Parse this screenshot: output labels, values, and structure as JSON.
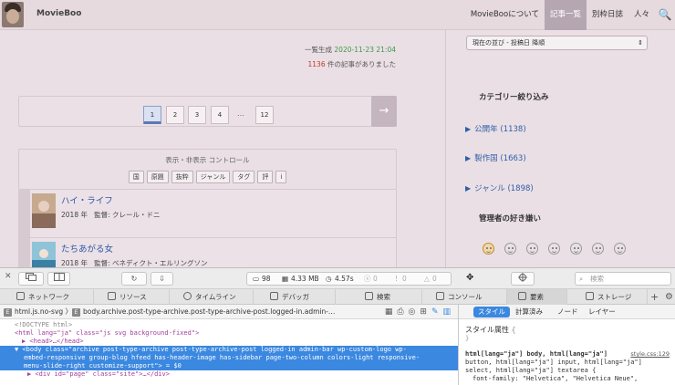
{
  "site": {
    "title": "MovieBoo",
    "nav": [
      {
        "label": "MovieBooについて"
      },
      {
        "label": "記事一覧"
      },
      {
        "label": "別枠日誌"
      },
      {
        "label": "人々"
      }
    ],
    "search_icon": "🔍"
  },
  "main": {
    "gen_prefix": "一覧生成",
    "gen_date": "2020-11-23 21:04",
    "count": "1136",
    "count_suffix": "件の記事がありました",
    "pages": [
      "1",
      "2",
      "3",
      "4",
      "12"
    ],
    "dots": "…",
    "next_arrow": "→",
    "controls_title": "表示・非表示 コントロール",
    "controls": [
      "国",
      "原題",
      "抜粋",
      "ジャンル",
      "タグ",
      "評",
      "i"
    ],
    "movies": [
      {
        "title": "ハイ・ライフ",
        "year": "2018 年",
        "director": "監督: クレール・ドニ"
      },
      {
        "title": "たちあがる女",
        "year": "2018 年",
        "director": "監督: ベネディクト・エルリングソン"
      }
    ]
  },
  "sidebar": {
    "sort_select": "現在の並び - 投稿日 降順",
    "sort_arrow": "⇕",
    "category_heading": "カテゴリー絞り込み",
    "categories": [
      {
        "label": "公開年",
        "count": "(1138)"
      },
      {
        "label": "製作国",
        "count": "(1663)"
      },
      {
        "label": "ジャンル",
        "count": "(1898)"
      }
    ],
    "admin_heading": "管理者の好き嫌い"
  },
  "devtools": {
    "toolbar": {
      "close": "✕",
      "reload": "↻",
      "download": "⇩",
      "doc_count": "98",
      "size": "4.33 MB",
      "time": "4.57s",
      "errors": "0",
      "warnings": "0",
      "logs": "0",
      "search_placeholder": "検索"
    },
    "tabs": [
      "ネットワーク",
      "リソース",
      "タイムライン",
      "デバッガ",
      "検索",
      "コンソール",
      "要素",
      "ストレージ"
    ],
    "add_tab": "+",
    "breadcrumbs": [
      "html.js.no-svg",
      "body.archive.post-type-archive.post-type-archive-post.logged-in.admin-…"
    ],
    "dom": {
      "doctype": "<!DOCTYPE html>",
      "html_open": "<html lang=\"ja\" class=\"js svg background-fixed\">",
      "head": "▶ <head>…</head>",
      "body_line1": "▼ <body class=\"archive post-type-archive post-type-archive-post logged-in admin-bar wp-custom-logo wp-",
      "body_line2": "embed-responsive group-blog hfeed has-header-image has-sidebar page-two-column colors-light responsive-",
      "body_line3": "menu-slide-right customize-support\"> = $0",
      "page_div": "▶ <div id=\"page\" class=\"site\">…</div>"
    },
    "style_tabs": [
      "スタイル",
      "計算済み",
      "ノード",
      "レイヤー"
    ],
    "style_attr_label": "スタイル属性",
    "style_brace": "}",
    "style_selector": "html[lang=\"ja\"] body, html[lang=\"ja\"]",
    "style_selector2": "button, html[lang=\"ja\"] input, html[lang=\"ja\"]",
    "style_selector3": "select, html[lang=\"ja\"] textarea {",
    "style_prop": "font-family: \"Helvetica\", \"Helvetica Neue\",",
    "style_source": "style.css:129"
  }
}
